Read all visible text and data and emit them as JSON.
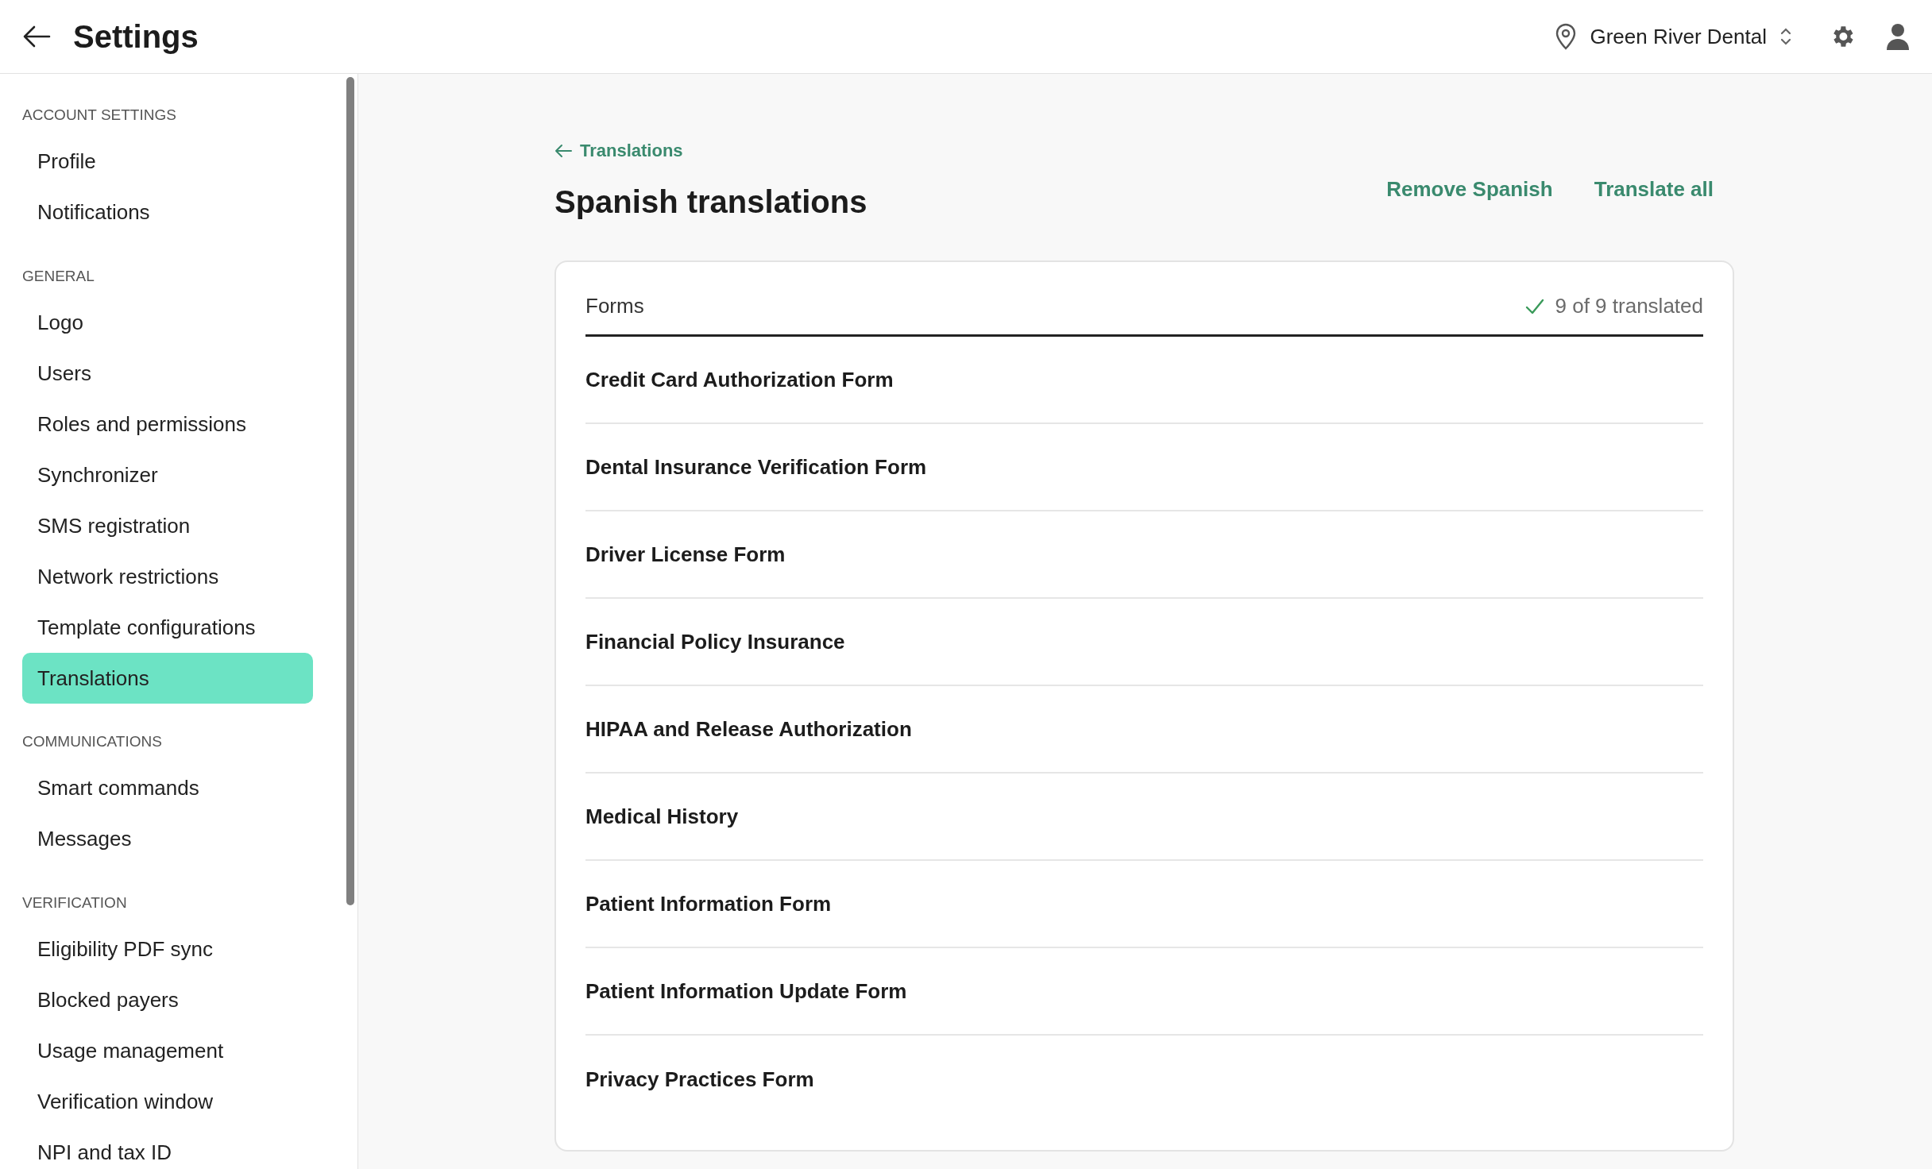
{
  "header": {
    "title": "Settings",
    "location": "Green River Dental"
  },
  "sidebar": {
    "sections": [
      {
        "heading": "ACCOUNT SETTINGS",
        "items": [
          {
            "label": "Profile",
            "selected": false
          },
          {
            "label": "Notifications",
            "selected": false
          }
        ]
      },
      {
        "heading": "GENERAL",
        "items": [
          {
            "label": "Logo",
            "selected": false
          },
          {
            "label": "Users",
            "selected": false
          },
          {
            "label": "Roles and permissions",
            "selected": false
          },
          {
            "label": "Synchronizer",
            "selected": false
          },
          {
            "label": "SMS registration",
            "selected": false
          },
          {
            "label": "Network restrictions",
            "selected": false
          },
          {
            "label": "Template configurations",
            "selected": false
          },
          {
            "label": "Translations",
            "selected": true
          }
        ]
      },
      {
        "heading": "COMMUNICATIONS",
        "items": [
          {
            "label": "Smart commands",
            "selected": false
          },
          {
            "label": "Messages",
            "selected": false
          }
        ]
      },
      {
        "heading": "VERIFICATION",
        "items": [
          {
            "label": "Eligibility PDF sync",
            "selected": false
          },
          {
            "label": "Blocked payers",
            "selected": false
          },
          {
            "label": "Usage management",
            "selected": false
          },
          {
            "label": "Verification window",
            "selected": false
          },
          {
            "label": "NPI and tax ID",
            "selected": false
          }
        ]
      }
    ]
  },
  "main": {
    "back_link": "Translations",
    "title": "Spanish translations",
    "actions": [
      "Remove Spanish",
      "Translate all"
    ],
    "card": {
      "heading": "Forms",
      "status": "9 of 9 translated",
      "rows": [
        "Credit Card Authorization Form",
        "Dental Insurance Verification Form",
        "Driver License Form",
        "Financial Policy Insurance",
        "HIPAA and Release Authorization",
        "Medical History",
        "Patient Information Form",
        "Patient Information Update Form",
        "Privacy Practices Form"
      ]
    }
  }
}
